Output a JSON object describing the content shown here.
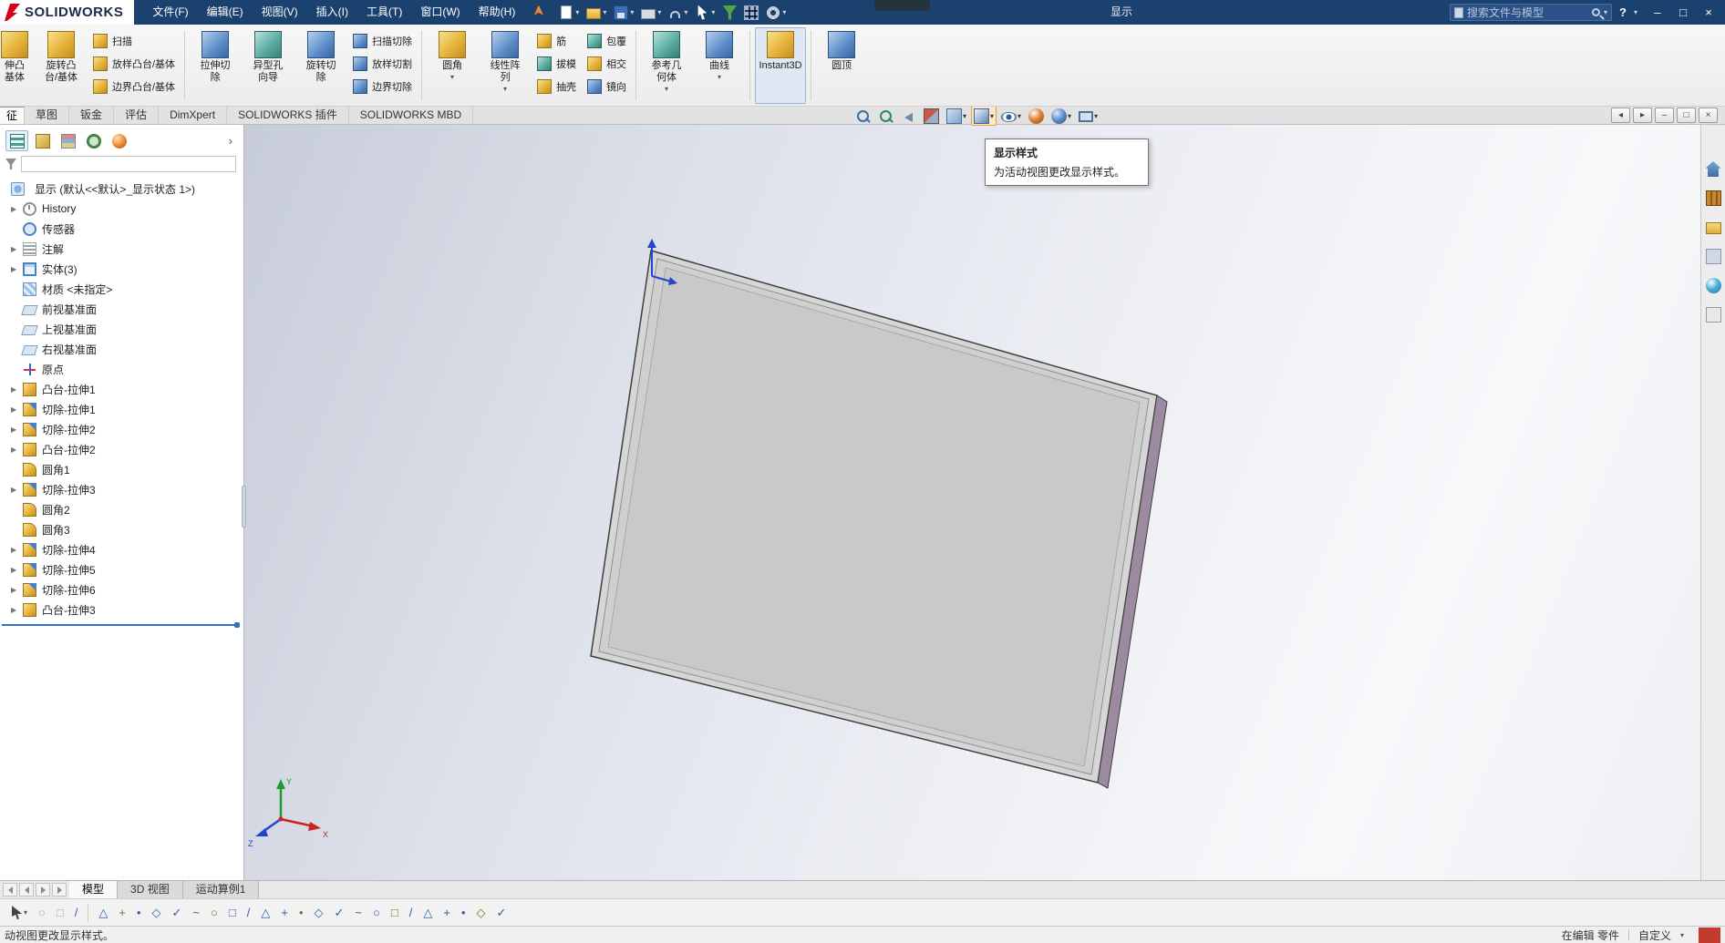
{
  "titlebar": {
    "brand": "SOLIDWORKS",
    "menus": [
      "文件(F)",
      "编辑(E)",
      "视图(V)",
      "插入(I)",
      "工具(T)",
      "窗口(W)",
      "帮助(H)"
    ],
    "quick_access": [
      {
        "name": "new-document",
        "shape": "page",
        "dropdown": true
      },
      {
        "name": "open",
        "shape": "folder",
        "dropdown": true
      },
      {
        "name": "save",
        "shape": "save",
        "dropdown": true
      },
      {
        "name": "print",
        "shape": "print",
        "dropdown": true
      },
      {
        "name": "undo",
        "shape": "undo",
        "dropdown": true
      },
      {
        "name": "select",
        "shape": "cursor",
        "dropdown": true
      },
      {
        "name": "selection-filter",
        "shape": "filter",
        "dropdown": false
      },
      {
        "name": "display-settings",
        "shape": "grid",
        "dropdown": false
      },
      {
        "name": "options",
        "shape": "gear",
        "dropdown": true
      }
    ],
    "document_title": "显示",
    "search_placeholder": "搜索文件与模型",
    "help_label": "?"
  },
  "ribbon": {
    "groups": [
      {
        "items": [
          {
            "type": "large",
            "name": "extruded-boss",
            "lines": [
              "伸凸",
              "基体"
            ],
            "icon": "gold",
            "clipped": true
          },
          {
            "type": "large",
            "name": "revolved-boss",
            "lines": [
              "旋转凸",
              "台/基体"
            ],
            "icon": "gold"
          },
          {
            "type": "stack",
            "rows": [
              {
                "name": "swept-boss",
                "label": "扫描",
                "icon": "gold"
              },
              {
                "name": "lofted-boss",
                "label": "放样凸台/基体",
                "icon": "gold"
              },
              {
                "name": "boundary-boss",
                "label": "边界凸台/基体",
                "icon": "gold"
              }
            ]
          }
        ]
      },
      {
        "items": [
          {
            "type": "large",
            "name": "extruded-cut",
            "lines": [
              "拉伸切",
              "除"
            ],
            "icon": "blue"
          },
          {
            "type": "large",
            "name": "hole-wizard",
            "lines": [
              "异型孔",
              "向导"
            ],
            "icon": "teal"
          },
          {
            "type": "large",
            "name": "revolved-cut",
            "lines": [
              "旋转切",
              "除"
            ],
            "icon": "blue"
          },
          {
            "type": "stack",
            "rows": [
              {
                "name": "swept-cut",
                "label": "扫描切除",
                "icon": "blue"
              },
              {
                "name": "lofted-cut",
                "label": "放样切割",
                "icon": "blue"
              },
              {
                "name": "boundary-cut",
                "label": "边界切除",
                "icon": "blue"
              }
            ]
          }
        ]
      },
      {
        "items": [
          {
            "type": "large",
            "name": "fillet",
            "lines": [
              "圆角"
            ],
            "icon": "gold",
            "dropdown": true
          },
          {
            "type": "large",
            "name": "linear-pattern",
            "lines": [
              "线性阵",
              "列"
            ],
            "icon": "blue",
            "dropdown": true
          },
          {
            "type": "stack",
            "rows": [
              {
                "name": "rib",
                "label": "筋",
                "icon": "gold"
              },
              {
                "name": "draft",
                "label": "拔模",
                "icon": "teal"
              },
              {
                "name": "shell",
                "label": "抽壳",
                "icon": "gold"
              }
            ]
          },
          {
            "type": "stack",
            "rows": [
              {
                "name": "wrap",
                "label": "包覆",
                "icon": "teal"
              },
              {
                "name": "intersect",
                "label": "相交",
                "icon": "gold"
              },
              {
                "name": "mirror",
                "label": "镜向",
                "icon": "blue"
              }
            ]
          }
        ]
      },
      {
        "items": [
          {
            "type": "large",
            "name": "reference-geometry",
            "lines": [
              "参考几",
              "何体"
            ],
            "icon": "teal",
            "dropdown": true
          },
          {
            "type": "large",
            "name": "curves",
            "lines": [
              "曲线"
            ],
            "icon": "blue",
            "dropdown": true
          }
        ]
      },
      {
        "items": [
          {
            "type": "large",
            "name": "instant3d",
            "lines": [
              "Instant3D"
            ],
            "icon": "gold",
            "selected": true
          }
        ]
      },
      {
        "items": [
          {
            "type": "large",
            "name": "dome",
            "lines": [
              "圆顶"
            ],
            "icon": "blue"
          }
        ]
      }
    ]
  },
  "command_tabs": [
    {
      "label": "征",
      "name": "tab-features",
      "active": true
    },
    {
      "label": "草图",
      "name": "tab-sketch",
      "active": false
    },
    {
      "label": "钣金",
      "name": "tab-sheet-metal",
      "active": false
    },
    {
      "label": "评估",
      "name": "tab-evaluate",
      "active": false
    },
    {
      "label": "DimXpert",
      "name": "tab-dimxpert",
      "active": false
    },
    {
      "label": "SOLIDWORKS 插件",
      "name": "tab-solidworks-addins",
      "active": false
    },
    {
      "label": "SOLIDWORKS MBD",
      "name": "tab-solidworks-mbd",
      "active": false
    }
  ],
  "headsup": {
    "tools": [
      {
        "name": "zoom-to-fit",
        "shape": "magnifier",
        "dropdown": false,
        "hover": false
      },
      {
        "name": "zoom-to-area",
        "shape": "magnifier-plus",
        "dropdown": false,
        "hover": false
      },
      {
        "name": "previous-view",
        "shape": "view-back",
        "dropdown": false,
        "hover": false
      },
      {
        "name": "section-view",
        "shape": "section",
        "dropdown": false,
        "hover": false
      },
      {
        "name": "view-orientation",
        "shape": "cube",
        "dropdown": true,
        "hover": false
      },
      {
        "name": "display-style",
        "shape": "cube-shaded",
        "dropdown": true,
        "hover": true
      },
      {
        "name": "hide-show-items",
        "shape": "eye",
        "dropdown": true,
        "hover": false
      },
      {
        "name": "edit-appearance",
        "shape": "ball",
        "dropdown": false,
        "hover": false
      },
      {
        "name": "apply-scene",
        "shape": "scene",
        "dropdown": true,
        "hover": false
      },
      {
        "name": "view-settings",
        "shape": "monitor",
        "dropdown": true,
        "hover": false
      }
    ]
  },
  "tooltip": {
    "title": "显示样式",
    "body": "为活动视图更改显示样式。"
  },
  "manager_tabs": [
    "feature-manager",
    "property-manager",
    "configuration-manager",
    "dimxpert-manager",
    "display-manager"
  ],
  "feature_tree": {
    "root_label": "显示 (默认<<默认>_显示状态 1>)",
    "items": [
      {
        "label": "History",
        "icon": "history",
        "caret": true
      },
      {
        "label": "传感器",
        "icon": "sensor",
        "caret": false
      },
      {
        "label": "注解",
        "icon": "annotations",
        "caret": true
      },
      {
        "label": "实体(3)",
        "icon": "bodies",
        "caret": true
      },
      {
        "label": "材质 <未指定>",
        "icon": "material",
        "caret": false
      },
      {
        "label": "前视基准面",
        "icon": "plane",
        "caret": false
      },
      {
        "label": "上视基准面",
        "icon": "plane",
        "caret": false
      },
      {
        "label": "右视基准面",
        "icon": "plane",
        "caret": false
      },
      {
        "label": "原点",
        "icon": "origin",
        "caret": false
      },
      {
        "label": "凸台-拉伸1",
        "icon": "boss",
        "caret": true
      },
      {
        "label": "切除-拉伸1",
        "icon": "cut",
        "caret": true
      },
      {
        "label": "切除-拉伸2",
        "icon": "cut",
        "caret": true
      },
      {
        "label": "凸台-拉伸2",
        "icon": "boss",
        "caret": true
      },
      {
        "label": "圆角1",
        "icon": "fillet",
        "caret": false
      },
      {
        "label": "切除-拉伸3",
        "icon": "cut",
        "caret": true
      },
      {
        "label": "圆角2",
        "icon": "fillet",
        "caret": false
      },
      {
        "label": "圆角3",
        "icon": "fillet",
        "caret": false
      },
      {
        "label": "切除-拉伸4",
        "icon": "cut",
        "caret": true
      },
      {
        "label": "切除-拉伸5",
        "icon": "cut",
        "caret": true
      },
      {
        "label": "切除-拉伸6",
        "icon": "cut",
        "caret": true
      },
      {
        "label": "凸台-拉伸3",
        "icon": "boss",
        "caret": true
      }
    ]
  },
  "viewport": {
    "triad_labels": [
      "X",
      "Y",
      "Z"
    ]
  },
  "task_pane_icons": [
    "solidworks-resources",
    "design-library",
    "file-explorer",
    "view-palette",
    "appearances-scenes",
    "custom-properties"
  ],
  "bottom_tabs": {
    "items": [
      {
        "label": "模型",
        "name": "tab-model",
        "active": true
      },
      {
        "label": "3D 视图",
        "name": "tab-3d-views",
        "active": false
      },
      {
        "label": "运动算例1",
        "name": "tab-motion-study-1",
        "active": false
      }
    ]
  },
  "sketch_toolbar": {
    "tool_count": 26
  },
  "statusbar": {
    "message": "动视图更改显示样式。",
    "mode": "在编辑 零件",
    "custom_label": "自定义"
  },
  "colors": {
    "titlebar": "#1b416f",
    "accent_blue": "#2f72c4",
    "model_face": "#d6d6d6",
    "model_side": "#9b8aa0"
  }
}
